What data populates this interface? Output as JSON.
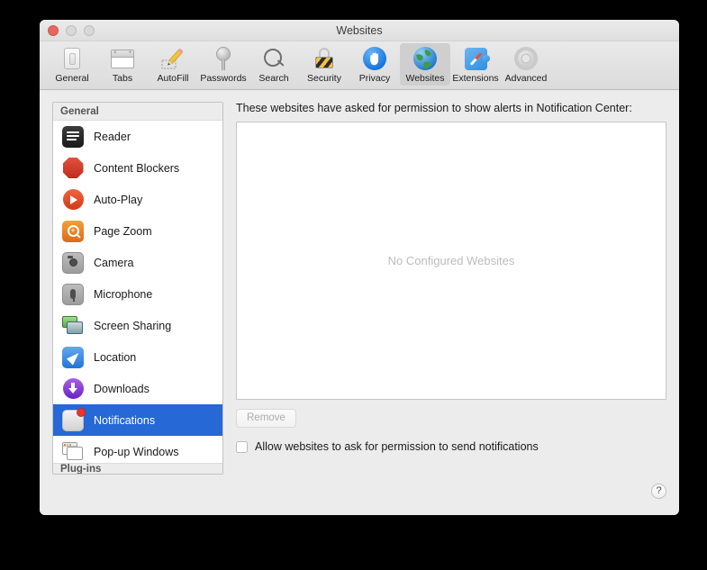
{
  "window": {
    "title": "Websites",
    "traffic_lights": [
      "close-button",
      "minimize-button",
      "zoom-button"
    ]
  },
  "toolbar": {
    "items": [
      {
        "label": "General",
        "icon": "general-icon",
        "selected": false
      },
      {
        "label": "Tabs",
        "icon": "tabs-icon",
        "selected": false
      },
      {
        "label": "AutoFill",
        "icon": "autofill-icon",
        "selected": false
      },
      {
        "label": "Passwords",
        "icon": "key-icon",
        "selected": false
      },
      {
        "label": "Search",
        "icon": "magnifier-icon",
        "selected": false
      },
      {
        "label": "Security",
        "icon": "lock-icon",
        "selected": false
      },
      {
        "label": "Privacy",
        "icon": "hand-icon",
        "selected": false
      },
      {
        "label": "Websites",
        "icon": "globe-icon",
        "selected": true
      },
      {
        "label": "Extensions",
        "icon": "puzzle-icon",
        "selected": false
      },
      {
        "label": "Advanced",
        "icon": "gear-icon",
        "selected": false
      }
    ]
  },
  "sidebar": {
    "group_header": "General",
    "clipped_group_header": "Plug-ins",
    "items": [
      {
        "label": "Reader",
        "icon": "reader-icon",
        "selected": false
      },
      {
        "label": "Content Blockers",
        "icon": "stop-sign-icon",
        "selected": false
      },
      {
        "label": "Auto-Play",
        "icon": "play-circle-icon",
        "selected": false
      },
      {
        "label": "Page Zoom",
        "icon": "zoom-magnifier-icon",
        "selected": false
      },
      {
        "label": "Camera",
        "icon": "camera-icon",
        "selected": false
      },
      {
        "label": "Microphone",
        "icon": "microphone-icon",
        "selected": false
      },
      {
        "label": "Screen Sharing",
        "icon": "screen-sharing-icon",
        "selected": false
      },
      {
        "label": "Location",
        "icon": "location-arrow-icon",
        "selected": false
      },
      {
        "label": "Downloads",
        "icon": "download-icon",
        "selected": false
      },
      {
        "label": "Notifications",
        "icon": "notifications-icon",
        "selected": true
      },
      {
        "label": "Pop-up Windows",
        "icon": "popup-windows-icon",
        "selected": false
      }
    ]
  },
  "main": {
    "caption": "These websites have asked for permission to show alerts in Notification Center:",
    "empty_message": "No Configured Websites",
    "remove_button": "Remove",
    "remove_button_enabled": false,
    "allow_checkbox_label": "Allow websites to ask for permission to send notifications",
    "allow_checkbox_checked": false
  },
  "footer": {
    "help_button": "?"
  },
  "colors": {
    "selection_blue": "#2568d6",
    "window_bg": "#ececec",
    "toolbar_selected": "#cfcfcf",
    "close_red": "#e8675c",
    "placeholder_gray": "#bcbcbc"
  }
}
